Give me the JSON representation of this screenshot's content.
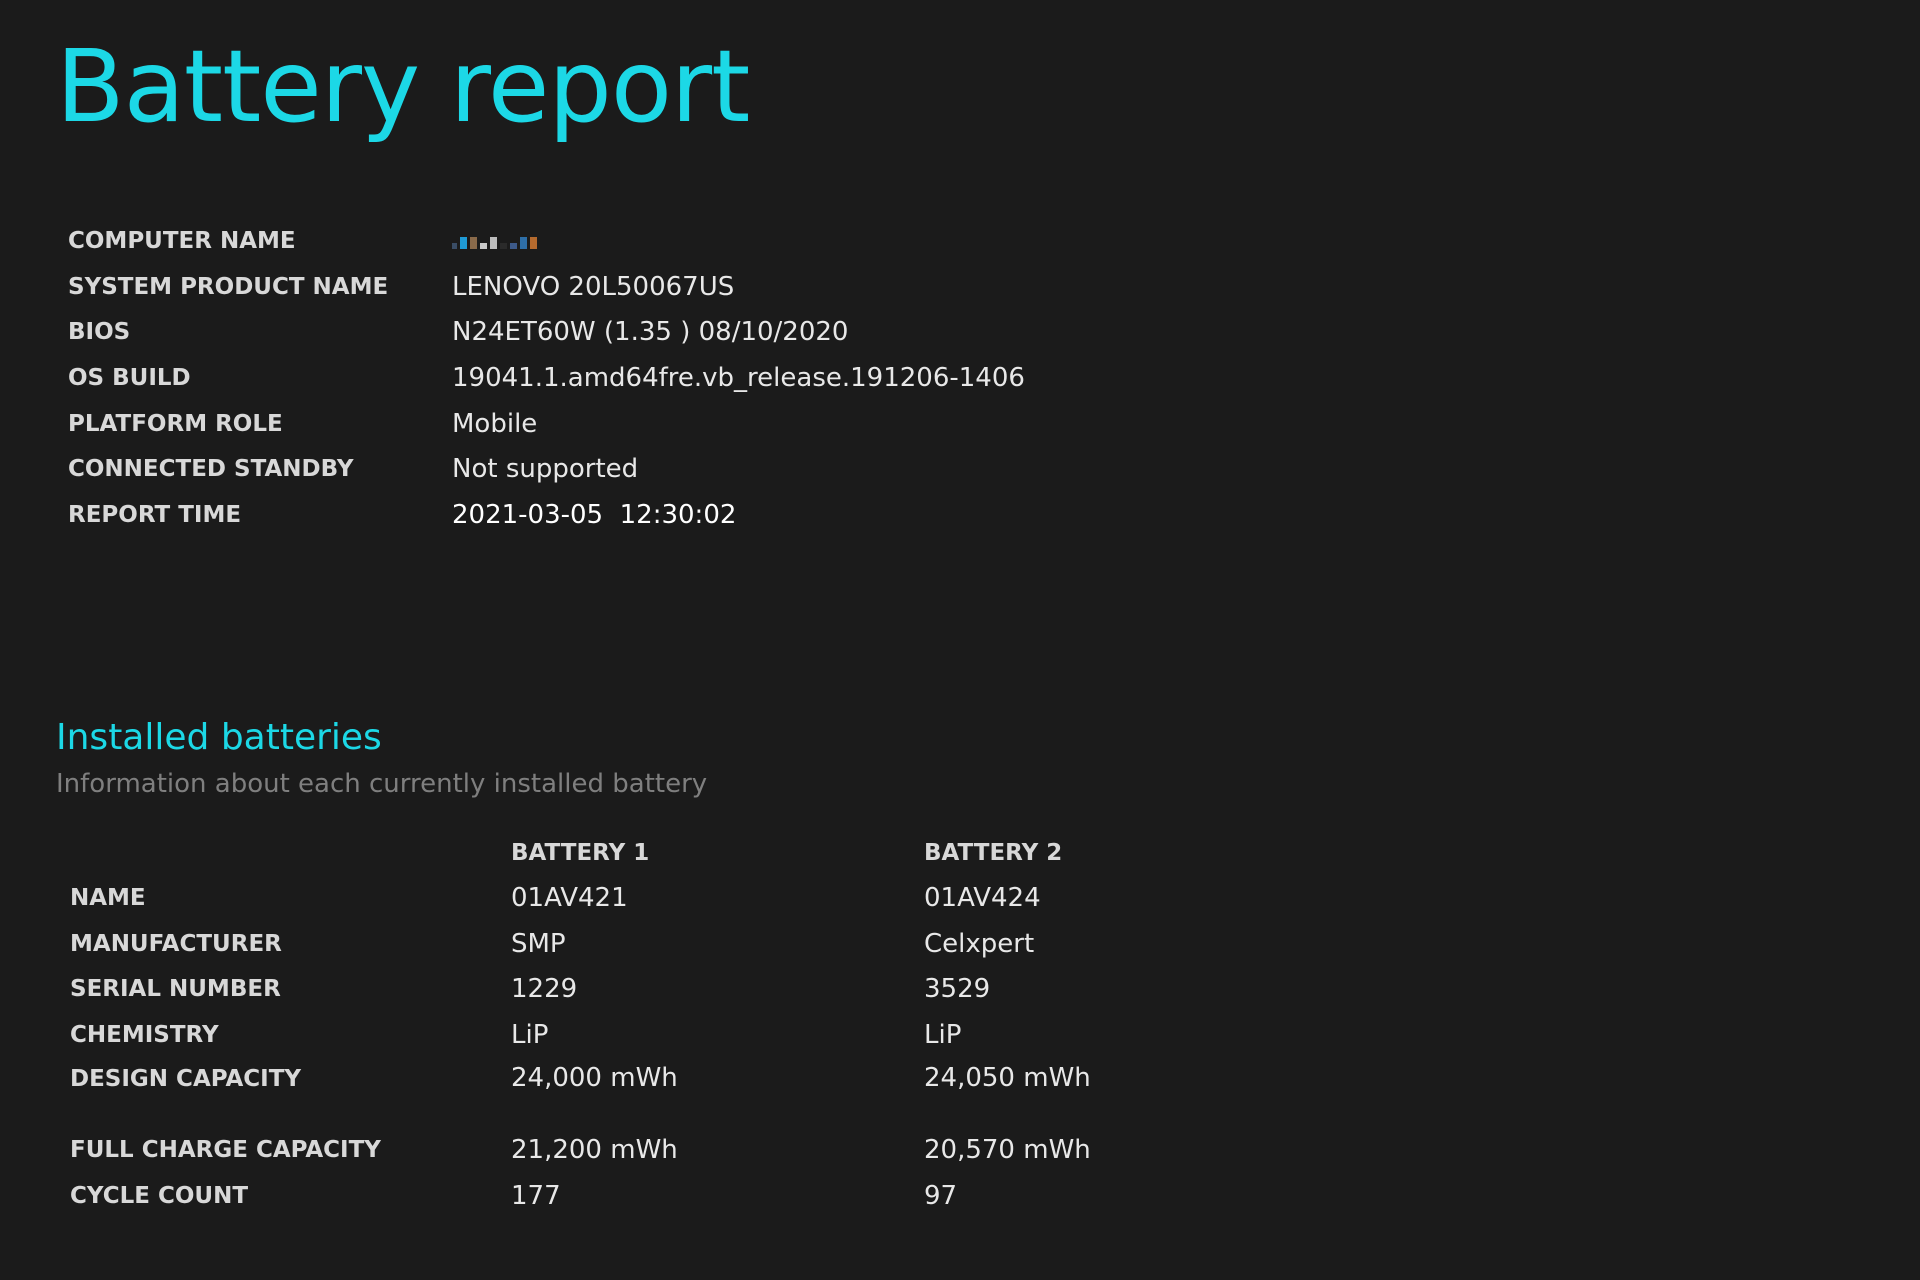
{
  "report": {
    "title": "Battery report"
  },
  "system_info": [
    {
      "label": "COMPUTER NAME",
      "value": "",
      "redacted": true
    },
    {
      "label": "SYSTEM PRODUCT NAME",
      "value": "LENOVO 20L50067US"
    },
    {
      "label": "BIOS",
      "value": "N24ET60W (1.35 ) 08/10/2020"
    },
    {
      "label": "OS BUILD",
      "value": "19041.1.amd64fre.vb_release.191206-1406"
    },
    {
      "label": "PLATFORM ROLE",
      "value": "Mobile"
    },
    {
      "label": "CONNECTED STANDBY",
      "value": "Not supported"
    },
    {
      "label": "REPORT TIME",
      "value": "2021-03-05  12:30:02"
    }
  ],
  "redacted_colors": [
    "#2e6fa8",
    "#8a6a4a",
    "#c9c9c9",
    "#1f9bd6",
    "#3d5a8a",
    "#b56a2e",
    "#9fb9d6"
  ],
  "installed_batteries": {
    "title": "Installed batteries",
    "subtitle": "Information about each currently installed battery",
    "columns": [
      "BATTERY 1",
      "BATTERY 2"
    ],
    "rows": [
      {
        "label": "NAME",
        "values": [
          "01AV421",
          "01AV424"
        ]
      },
      {
        "label": "MANUFACTURER",
        "values": [
          "SMP",
          "Celxpert"
        ]
      },
      {
        "label": "SERIAL NUMBER",
        "values": [
          "1229",
          "3529"
        ]
      },
      {
        "label": "CHEMISTRY",
        "values": [
          "LiP",
          "LiP"
        ]
      },
      {
        "label": "DESIGN CAPACITY",
        "values": [
          "24,000 mWh",
          "24,050 mWh"
        ]
      },
      {
        "label": "FULL CHARGE CAPACITY",
        "values": [
          "21,200 mWh",
          "20,570 mWh"
        ]
      },
      {
        "label": "CYCLE COUNT",
        "values": [
          "177",
          "97"
        ]
      }
    ]
  },
  "colors": {
    "background": "#1b1b1b",
    "accent": "#1cd8e6",
    "label": "#d8d8d8",
    "value": "#e8e8e8",
    "subtitle": "#7f7f7f"
  }
}
